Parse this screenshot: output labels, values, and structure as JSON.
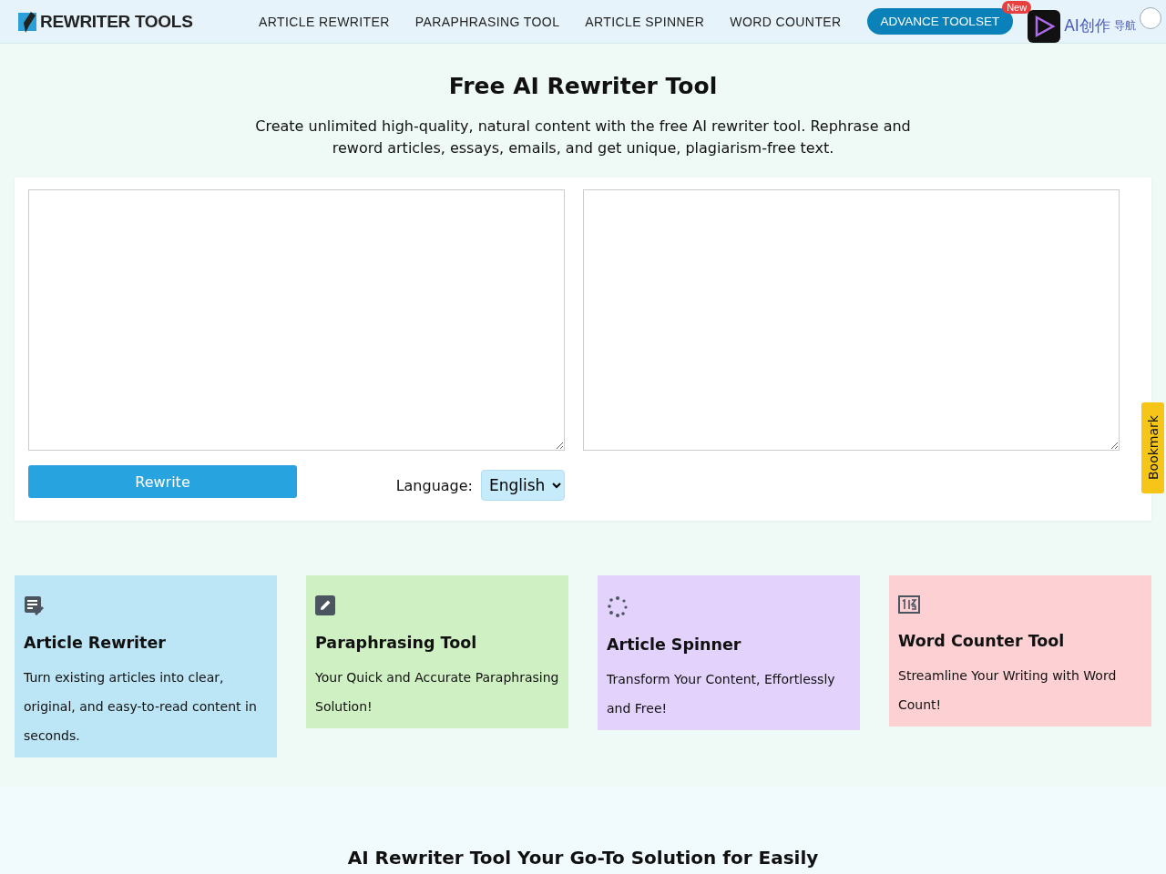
{
  "header": {
    "logo": "REWRITER TOOLS",
    "nav": [
      {
        "label": "ARTICLE REWRITER"
      },
      {
        "label": "PARAPHRASING TOOL"
      },
      {
        "label": "ARTICLE SPINNER"
      },
      {
        "label": "WORD COUNTER"
      }
    ],
    "cta": {
      "label": "ADVANCE TOOLSET",
      "badge": "New"
    },
    "extension": {
      "label": "AI创作",
      "overlay": "导航"
    }
  },
  "hero": {
    "title": "Free AI Rewriter Tool",
    "description": "Create unlimited high-quality, natural content with the free AI rewriter tool. Rephrase and reword articles, essays, emails, and get unique, plagiarism-free text."
  },
  "editor": {
    "rewrite_button": "Rewrite",
    "language_label": "Language:",
    "language": "English"
  },
  "bookmark": "Bookmark",
  "cards": [
    {
      "kind": "rewriter",
      "color": "#bce5f5",
      "title": "Article Rewriter",
      "text": "Turn existing articles into clear, original, and easy-to-read content in seconds."
    },
    {
      "kind": "paraphrase",
      "color": "#cff0c2",
      "title": "Paraphrasing Tool",
      "text": "Your Quick and Accurate Paraphrasing Solution!"
    },
    {
      "kind": "spinner",
      "color": "#e2d2fc",
      "title": "Article Spinner",
      "text": "Transform Your Content, Effortlessly and Free!"
    },
    {
      "kind": "counter",
      "color": "#fdd1d3",
      "title": "Word Counter Tool",
      "text": "Streamline Your Writing with Word Count!"
    }
  ],
  "section": {
    "heading": "**AI Rewriter Tool** Your Go-To Solution for Easily"
  }
}
